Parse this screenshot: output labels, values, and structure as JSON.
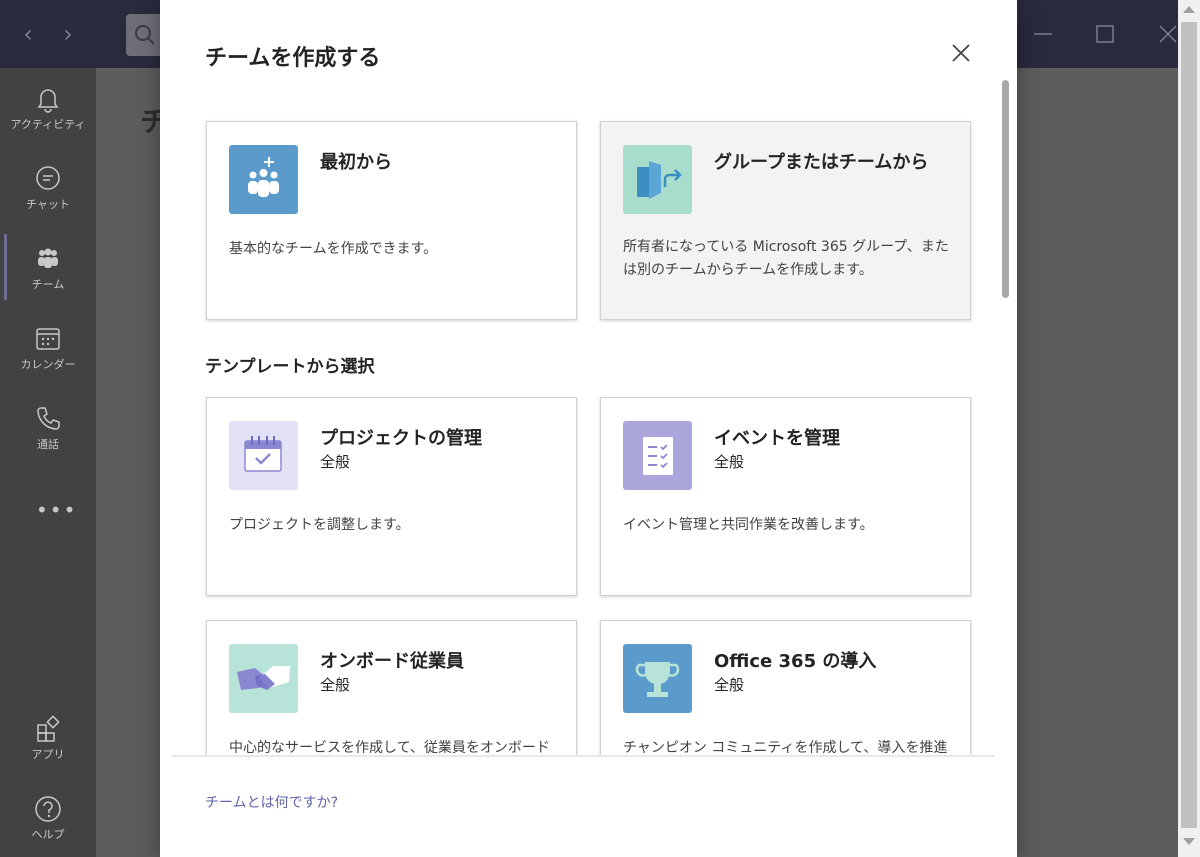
{
  "rail": {
    "items": [
      {
        "label": "アクティビティ"
      },
      {
        "label": "チャット"
      },
      {
        "label": "チーム"
      },
      {
        "label": "カレンダー"
      },
      {
        "label": "通話"
      },
      {
        "label": "アプリ"
      },
      {
        "label": "ヘルプ"
      }
    ],
    "more": "•••"
  },
  "background": {
    "page_title_partial": "チ"
  },
  "dialog": {
    "title": "チームを作成する",
    "cards": [
      {
        "title": "最初から",
        "description": "基本的なチームを作成できます。",
        "icon": "people-add-icon",
        "icon_bg": "#5b9bcb"
      },
      {
        "title": "グループまたはチームから",
        "description": "所有者になっている Microsoft 365 グループ、または別のチームからチームを作成します。",
        "icon": "group-arrow-icon",
        "icon_bg": "#a8dccd"
      }
    ],
    "template_section_label": "テンプレートから選択",
    "templates": [
      {
        "title": "プロジェクトの管理",
        "subtitle": "全般",
        "description": "プロジェクトを調整します。",
        "icon": "calendar-check-icon",
        "icon_bg": "#e3e1f6"
      },
      {
        "title": "イベントを管理",
        "subtitle": "全般",
        "description": "イベント管理と共同作業を改善します。",
        "icon": "checklist-icon",
        "icon_bg": "#aaa6dc"
      },
      {
        "title": "オンボード従業員",
        "subtitle": "全般",
        "description": "中心的なサービスを作成して、従業員をオンボード",
        "icon": "handshake-icon",
        "icon_bg": "#b8e3d9"
      },
      {
        "title": "Office 365 の導入",
        "subtitle": "全般",
        "description": "チャンピオン コミュニティを作成して、導入を推進し",
        "icon": "trophy-icon",
        "icon_bg": "#5b9bcb"
      }
    ],
    "footer_link": "チームとは何ですか?"
  },
  "colors": {
    "accent": "#6264a7",
    "titlebar": "#292a3d",
    "overlay": "#5f5f5f"
  }
}
